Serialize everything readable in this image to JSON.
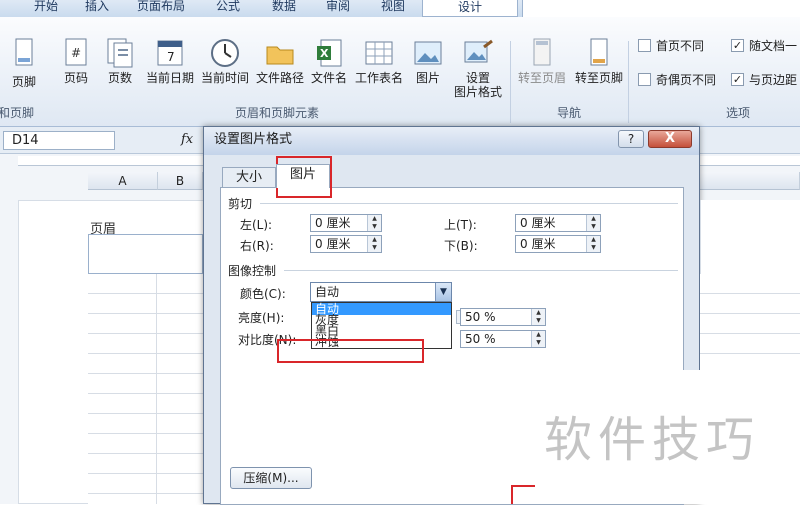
{
  "ribbon": {
    "tabs": [
      "开始",
      "插入",
      "页面布局",
      "公式",
      "数据",
      "审阅",
      "视图"
    ],
    "context_tab": "设计",
    "buttons": {
      "footer": "页脚",
      "page_num": "页码",
      "page_count": "页数",
      "cur_date": "当前日期",
      "cur_time": "当前时间",
      "file_path": "文件路径",
      "file_name": "文件名",
      "sheet_name": "工作表名",
      "picture": "图片",
      "format_pic_1": "设置",
      "format_pic_2": "图片格式",
      "goto_header": "转至页眉",
      "goto_footer": "转至页脚"
    },
    "groups": {
      "header_footer": "和页脚",
      "elements": "页眉和页脚元素",
      "nav": "导航",
      "options": "选项"
    },
    "options": [
      {
        "label": "首页不同",
        "checked": false
      },
      {
        "label": "随文档一",
        "checked": true
      },
      {
        "label": "奇偶页不同",
        "checked": false
      },
      {
        "label": "与页边距",
        "checked": true
      }
    ],
    "check_mark": "✓"
  },
  "formula_bar": {
    "cell": "D14",
    "fx": "fx"
  },
  "sheet": {
    "col_a": "A",
    "col_b": "B",
    "header_label": "页眉"
  },
  "dialog": {
    "title": "设置图片格式",
    "help": "?",
    "close": "X",
    "tabs": [
      "大小",
      "图片"
    ],
    "crop": {
      "title": "剪切",
      "left_label": "左(L):",
      "left_value": "0 厘米",
      "right_label": "右(R):",
      "right_value": "0 厘米",
      "top_label": "上(T):",
      "top_value": "0 厘米",
      "bottom_label": "下(B):",
      "bottom_value": "0 厘米"
    },
    "image_control": {
      "title": "图像控制",
      "color_label": "颜色(C):",
      "color_value": "自动",
      "brightness_label": "亮度(H):",
      "brightness_value": "50 %",
      "contrast_label": "对比度(N):",
      "contrast_value": "50 %",
      "color_options": [
        "自动",
        "灰度",
        "黑白",
        "冲蚀"
      ]
    },
    "compress_button": "压缩(M)..."
  },
  "watermark": "软件技巧",
  "colors": {
    "highlight": "#d9262a",
    "selection": "#3399ff"
  }
}
